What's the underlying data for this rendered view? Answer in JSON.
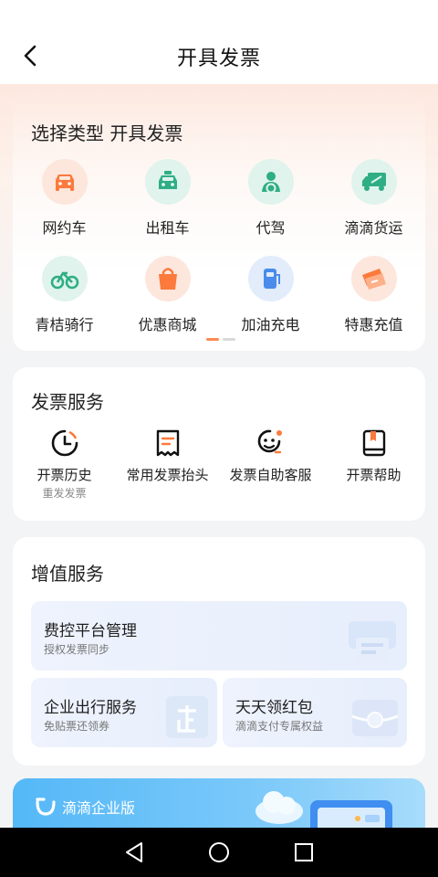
{
  "header": {
    "title": "开具发票"
  },
  "types": {
    "title": "选择类型 开具发票",
    "items": [
      {
        "label": "网约车",
        "icon": "car-icon"
      },
      {
        "label": "出租车",
        "icon": "taxi-icon"
      },
      {
        "label": "代驾",
        "icon": "designated-driver-icon"
      },
      {
        "label": "滴滴货运",
        "icon": "truck-icon"
      },
      {
        "label": "青桔骑行",
        "icon": "bicycle-icon"
      },
      {
        "label": "优惠商城",
        "icon": "shopping-bag-icon"
      },
      {
        "label": "加油充电",
        "icon": "fuel-pump-icon"
      },
      {
        "label": "特惠充值",
        "icon": "ticket-icon"
      }
    ]
  },
  "invoice_service": {
    "title": "发票服务",
    "items": [
      {
        "label": "开票历史",
        "sub": "重发发票",
        "icon": "clock-icon"
      },
      {
        "label": "常用发票抬头",
        "sub": "",
        "icon": "receipt-icon"
      },
      {
        "label": "发票自助客服",
        "sub": "",
        "icon": "customer-service-icon"
      },
      {
        "label": "开票帮助",
        "sub": "",
        "icon": "help-book-icon"
      }
    ]
  },
  "value_added": {
    "title": "增值服务",
    "items": [
      {
        "title": "费控平台管理",
        "subtitle": "授权发票同步"
      },
      {
        "title": "企业出行服务",
        "subtitle": "免贴票还领券"
      },
      {
        "title": "天天领红包",
        "subtitle": "滴滴支付专属权益"
      }
    ]
  },
  "banner": {
    "label": "滴滴企业版"
  },
  "colors": {
    "accent": "#fb7a3c",
    "mint": "#2fae85",
    "blue": "#4a8bec"
  }
}
